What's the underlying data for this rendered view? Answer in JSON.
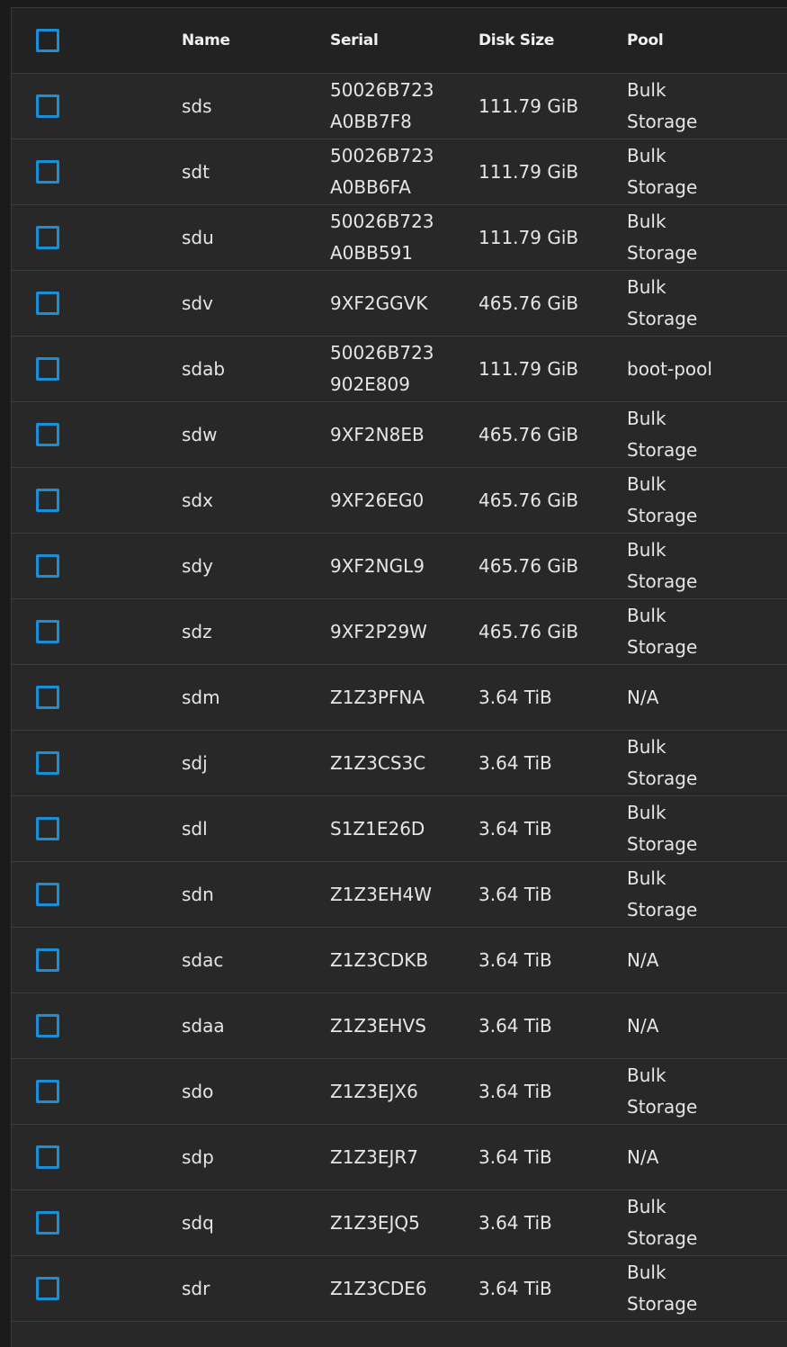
{
  "table": {
    "columns": {
      "name": "Name",
      "serial": "Serial",
      "disk_size": "Disk Size",
      "pool": "Pool"
    },
    "rows": [
      {
        "name": "sds",
        "serial": "50026B723\nA0BB7F8",
        "size": "111.79 GiB",
        "pool": "Bulk\nStorage"
      },
      {
        "name": "sdt",
        "serial": "50026B723\nA0BB6FA",
        "size": "111.79 GiB",
        "pool": "Bulk\nStorage"
      },
      {
        "name": "sdu",
        "serial": "50026B723\nA0BB591",
        "size": "111.79 GiB",
        "pool": "Bulk\nStorage"
      },
      {
        "name": "sdv",
        "serial": "9XF2GGVK",
        "size": "465.76 GiB",
        "pool": "Bulk\nStorage"
      },
      {
        "name": "sdab",
        "serial": "50026B723\n902E809",
        "size": "111.79 GiB",
        "pool": "boot-pool"
      },
      {
        "name": "sdw",
        "serial": "9XF2N8EB",
        "size": "465.76 GiB",
        "pool": "Bulk\nStorage"
      },
      {
        "name": "sdx",
        "serial": "9XF26EG0",
        "size": "465.76 GiB",
        "pool": "Bulk\nStorage"
      },
      {
        "name": "sdy",
        "serial": "9XF2NGL9",
        "size": "465.76 GiB",
        "pool": "Bulk\nStorage"
      },
      {
        "name": "sdz",
        "serial": "9XF2P29W",
        "size": "465.76 GiB",
        "pool": "Bulk\nStorage"
      },
      {
        "name": "sdm",
        "serial": "Z1Z3PFNA",
        "size": "3.64 TiB",
        "pool": "N/A"
      },
      {
        "name": "sdj",
        "serial": "Z1Z3CS3C",
        "size": "3.64 TiB",
        "pool": "Bulk\nStorage"
      },
      {
        "name": "sdl",
        "serial": "S1Z1E26D",
        "size": "3.64 TiB",
        "pool": "Bulk\nStorage"
      },
      {
        "name": "sdn",
        "serial": "Z1Z3EH4W",
        "size": "3.64 TiB",
        "pool": "Bulk\nStorage"
      },
      {
        "name": "sdac",
        "serial": "Z1Z3CDKB",
        "size": "3.64 TiB",
        "pool": "N/A"
      },
      {
        "name": "sdaa",
        "serial": "Z1Z3EHVS",
        "size": "3.64 TiB",
        "pool": "N/A"
      },
      {
        "name": "sdo",
        "serial": "Z1Z3EJX6",
        "size": "3.64 TiB",
        "pool": "Bulk\nStorage"
      },
      {
        "name": "sdp",
        "serial": "Z1Z3EJR7",
        "size": "3.64 TiB",
        "pool": "N/A"
      },
      {
        "name": "sdq",
        "serial": "Z1Z3EJQ5",
        "size": "3.64 TiB",
        "pool": "Bulk\nStorage"
      },
      {
        "name": "sdr",
        "serial": "Z1Z3CDE6",
        "size": "3.64 TiB",
        "pool": "Bulk\nStorage"
      }
    ]
  },
  "colors": {
    "checkbox_accent": "#1a8fd6",
    "background": "#282828",
    "header_background": "#222222"
  }
}
